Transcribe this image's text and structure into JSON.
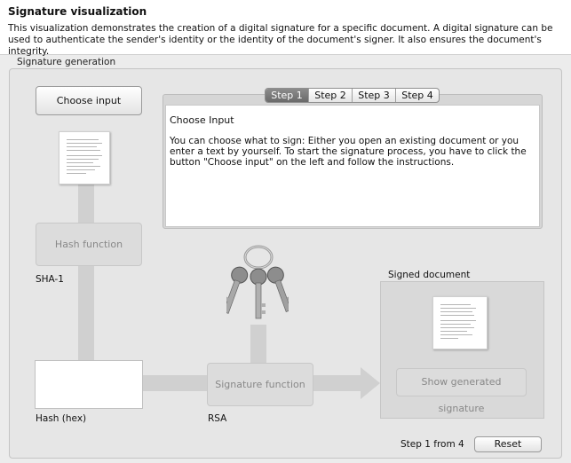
{
  "header": {
    "title": "Signature visualization",
    "description": "This visualization demonstrates the creation of a digital signature for a specific document. A digital signature can be used to authenticate the sender's identity or the identity of the document's signer. It also ensures the document's integrity."
  },
  "group": {
    "title": "Signature generation"
  },
  "buttons": {
    "choose_input": "Choose input",
    "hash_function": "Hash function",
    "signature_function": "Signature function",
    "show_signature": "Show generated signature",
    "reset": "Reset"
  },
  "tabs": [
    {
      "label": "Step 1",
      "active": true
    },
    {
      "label": "Step 2",
      "active": false
    },
    {
      "label": "Step 3",
      "active": false
    },
    {
      "label": "Step 4",
      "active": false
    }
  ],
  "step": {
    "title": "Choose Input",
    "text": "You can choose what to sign: Either you open an existing document or you enter a text by yourself. To start the signature process, you have to click the button \"Choose input\" on the left and follow the instructions."
  },
  "labels": {
    "sha1": "SHA-1",
    "hash_hex": "Hash (hex)",
    "rsa": "RSA",
    "signed_document": "Signed document",
    "progress": "Step 1 from 4"
  },
  "icons": {
    "document": "document-icon",
    "keys": "keys-icon",
    "arrow": "arrow-right-icon"
  }
}
